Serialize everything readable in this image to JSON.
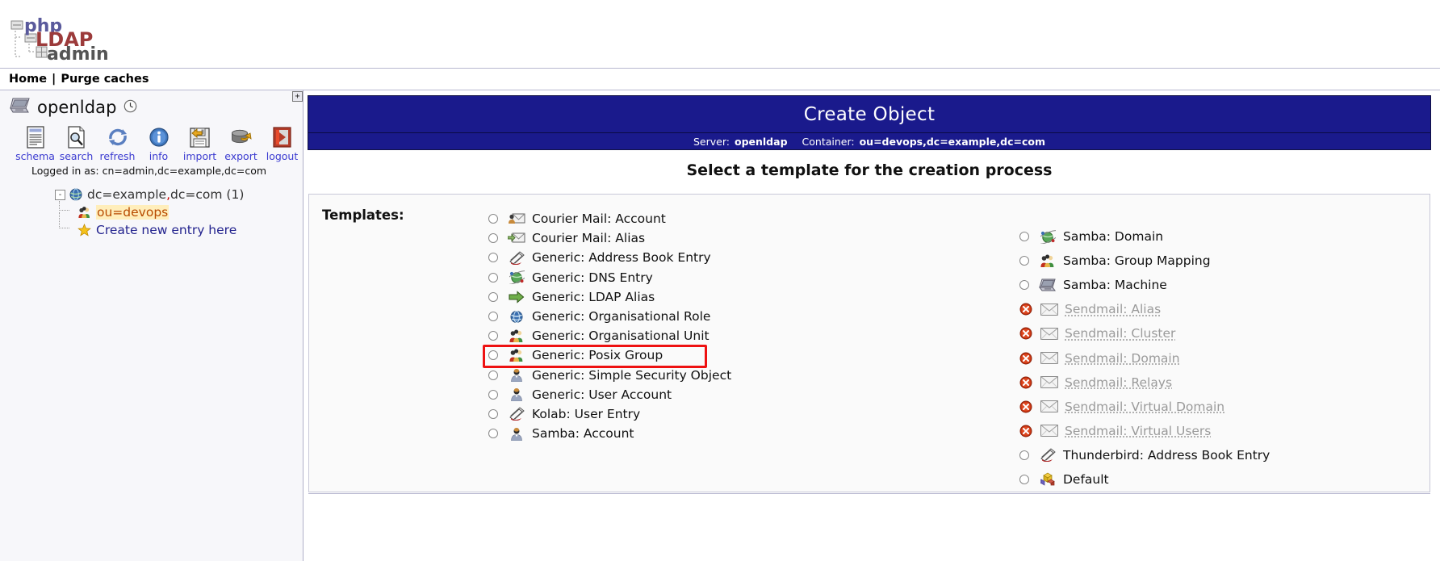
{
  "logo": {
    "alt": "phpLDAPadmin",
    "part1": "php",
    "part2": "LDAP",
    "part3": "admin"
  },
  "nav": {
    "home": "Home",
    "separator": "|",
    "purge": "Purge caches"
  },
  "sidebar": {
    "server_name": "openldap",
    "clock_icon": "clock-icon",
    "tools": [
      {
        "label": "schema",
        "icon": "schema-icon"
      },
      {
        "label": "search",
        "icon": "search-icon"
      },
      {
        "label": "refresh",
        "icon": "refresh-icon"
      },
      {
        "label": "info",
        "icon": "info-icon"
      },
      {
        "label": "import",
        "icon": "import-icon"
      },
      {
        "label": "export",
        "icon": "export-icon"
      },
      {
        "label": "logout",
        "icon": "logout-icon"
      }
    ],
    "logged_in_as": "Logged in as: cn=admin,dc=example,dc=com",
    "tree": {
      "root_expander": "-",
      "root_prefix": "dc=example",
      "root_comma": ",",
      "root_suffix": "dc=com",
      "root_count": "(1)",
      "child_label": "ou=devops",
      "create_label": "Create new entry here"
    }
  },
  "content": {
    "expand_toggle": "+",
    "title": "Create Object",
    "server_label": "Server:",
    "server_value": "openldap",
    "container_label": "Container:",
    "container_value": "ou=devops,dc=example,dc=com",
    "select_heading": "Select a template for the creation process",
    "templates_label": "Templates:",
    "highlight_color": "#ee1111",
    "templates_left": [
      {
        "label": "Courier Mail: Account",
        "icon": "mail-account-icon",
        "disabled": false
      },
      {
        "label": "Courier Mail: Alias",
        "icon": "mail-alias-icon",
        "disabled": false
      },
      {
        "label": "Generic: Address Book Entry",
        "icon": "address-book-icon",
        "disabled": false
      },
      {
        "label": "Generic: DNS Entry",
        "icon": "dns-globe-icon",
        "disabled": false
      },
      {
        "label": "Generic: LDAP Alias",
        "icon": "green-arrow-icon",
        "disabled": false
      },
      {
        "label": "Generic: Organisational Role",
        "icon": "globe-icon",
        "disabled": false
      },
      {
        "label": "Generic: Organisational Unit",
        "icon": "group-people-icon",
        "disabled": false
      },
      {
        "label": "Generic: Posix Group",
        "icon": "group-people-icon",
        "disabled": false,
        "highlighted": true
      },
      {
        "label": "Generic: Simple Security Object",
        "icon": "person-icon",
        "disabled": false
      },
      {
        "label": "Generic: User Account",
        "icon": "person-icon",
        "disabled": false
      },
      {
        "label": "Kolab: User Entry",
        "icon": "address-book-icon",
        "disabled": false
      },
      {
        "label": "Samba: Account",
        "icon": "person-icon",
        "disabled": false
      }
    ],
    "templates_right": [
      {
        "label": "Samba: Domain",
        "icon": "dns-globe-icon",
        "disabled": false
      },
      {
        "label": "Samba: Group Mapping",
        "icon": "group-people-icon",
        "disabled": false
      },
      {
        "label": "Samba: Machine",
        "icon": "computer-icon",
        "disabled": false
      },
      {
        "label": "Sendmail: Alias",
        "icon": "envelope-icon",
        "disabled": true
      },
      {
        "label": "Sendmail: Cluster",
        "icon": "envelope-icon",
        "disabled": true
      },
      {
        "label": "Sendmail: Domain",
        "icon": "envelope-icon",
        "disabled": true
      },
      {
        "label": "Sendmail: Relays",
        "icon": "envelope-icon",
        "disabled": true
      },
      {
        "label": "Sendmail: Virtual Domain",
        "icon": "envelope-icon",
        "disabled": true
      },
      {
        "label": "Sendmail: Virtual Users",
        "icon": "envelope-icon",
        "disabled": true
      },
      {
        "label": "Thunderbird: Address Book Entry",
        "icon": "address-book-icon",
        "disabled": false
      },
      {
        "label": "Default",
        "icon": "cubes-icon",
        "disabled": false
      }
    ]
  }
}
